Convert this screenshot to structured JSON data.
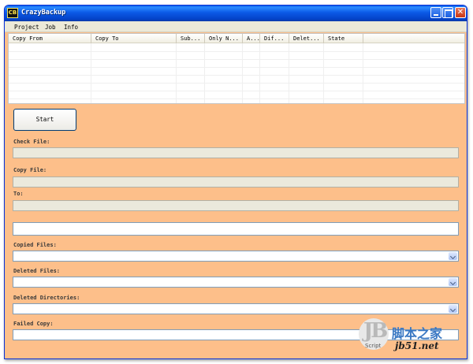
{
  "window": {
    "title": "CrazyBackup",
    "icon_text": "CB",
    "controls": {
      "minimize": "",
      "maximize": "",
      "close": "✕"
    }
  },
  "menu": [
    "Project",
    "Job",
    "Info"
  ],
  "table": {
    "columns": [
      "Copy From",
      "Copy To",
      "Sub...",
      "Only N...",
      "A...",
      "Dif...",
      "Delet...",
      "State"
    ],
    "rows": []
  },
  "start_button": "Start",
  "fields": {
    "check_file": {
      "label": "Check File:",
      "value": ""
    },
    "copy_file": {
      "label": "Copy File:",
      "value": ""
    },
    "to": {
      "label": "To:",
      "value": ""
    },
    "input": {
      "value": ""
    },
    "copied_files": {
      "label": "Copied Files:",
      "value": ""
    },
    "deleted_files": {
      "label": "Deleted Files:",
      "value": ""
    },
    "deleted_directories": {
      "label": "Deleted Directories:",
      "value": ""
    },
    "failed_copy": {
      "label": "Failed Copy:",
      "value": ""
    }
  },
  "watermark": {
    "logo": "JB",
    "script": "Script",
    "site_cn": "脚本之家",
    "url": "jb51.net"
  },
  "colors": {
    "panel": "#fdbf8a",
    "titlebar": "#0b59e6"
  }
}
